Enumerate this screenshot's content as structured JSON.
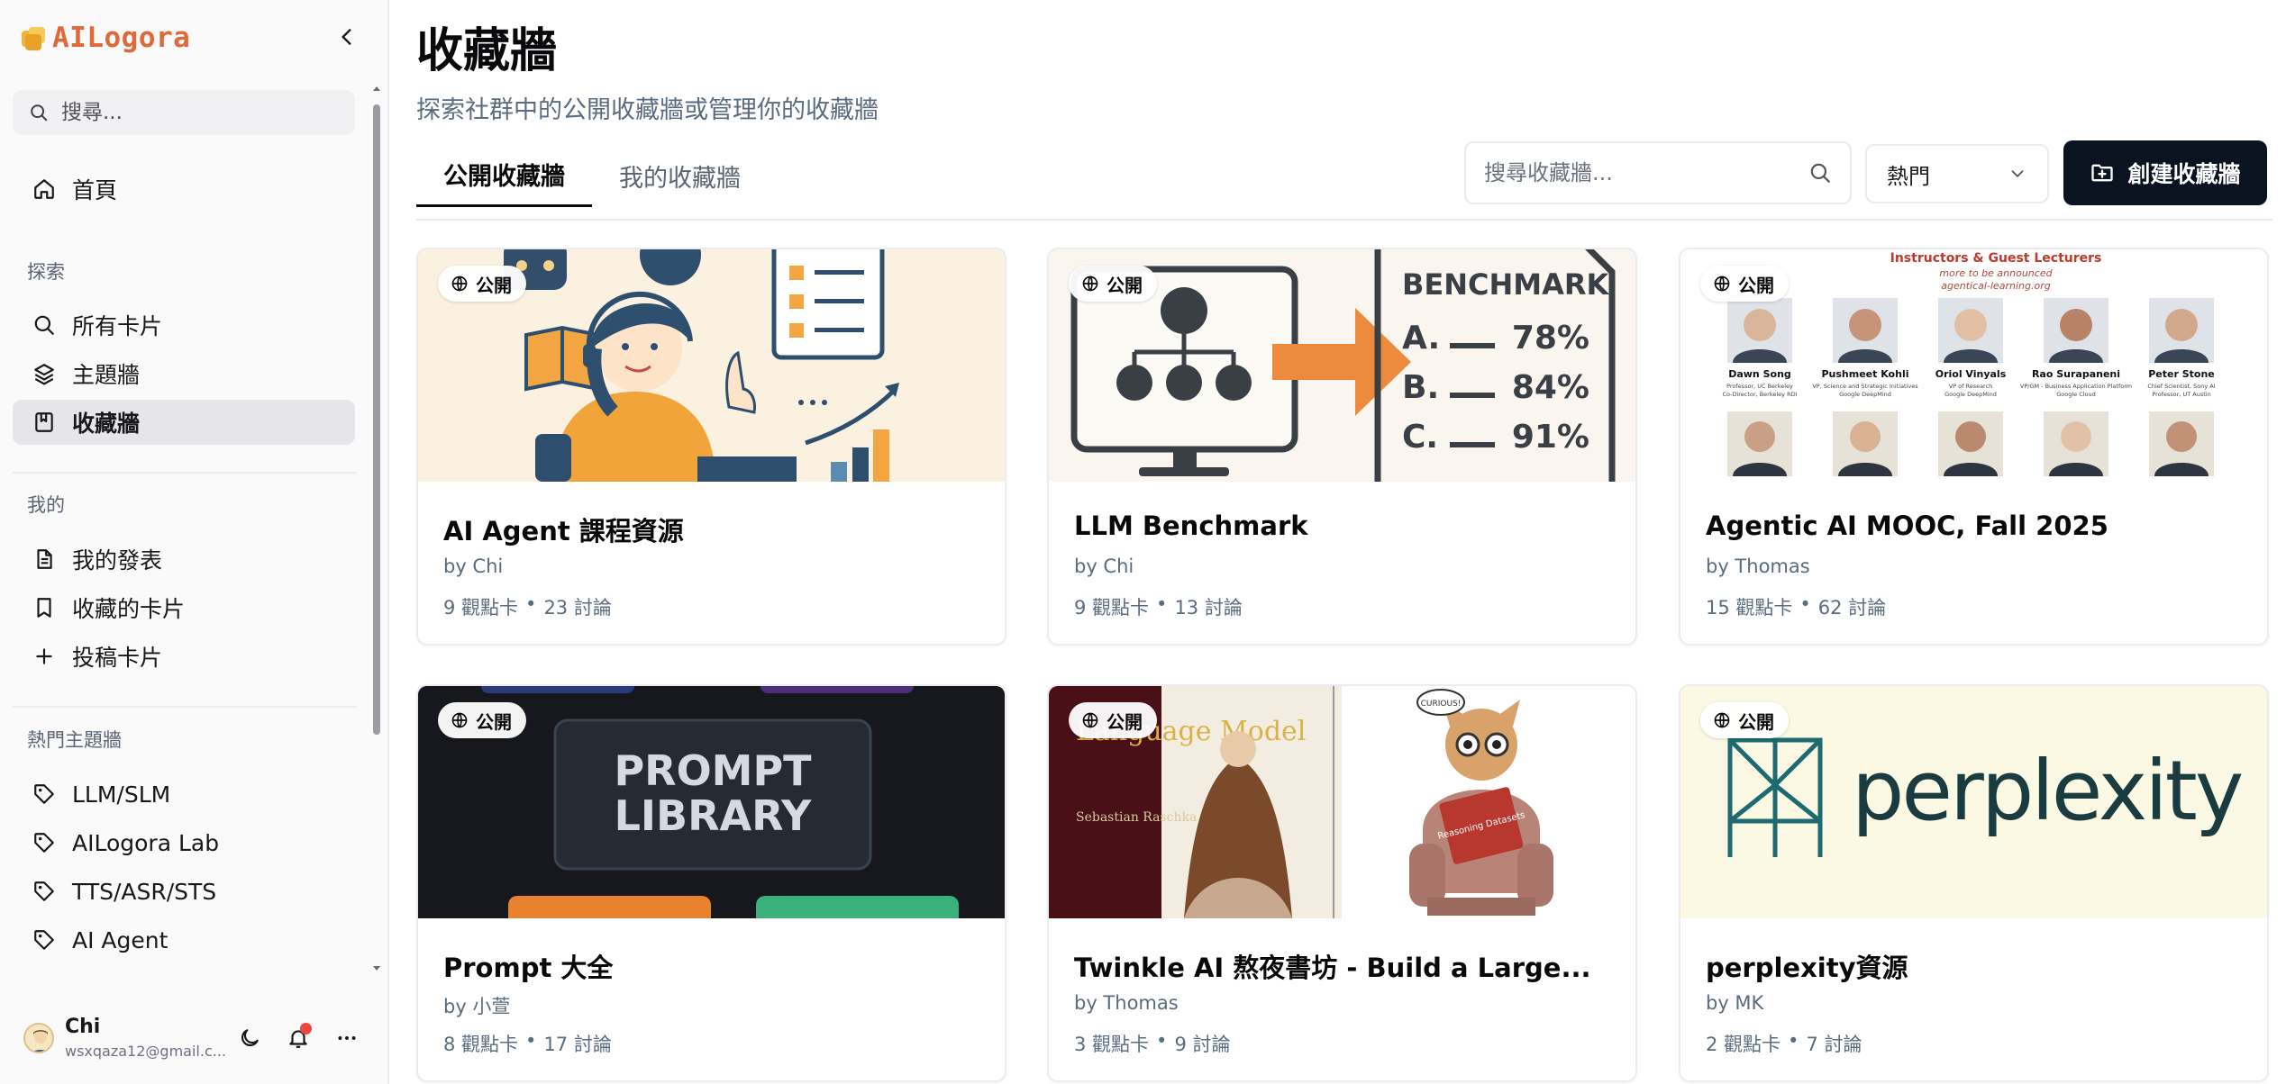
{
  "app": {
    "logo_text": "AILogora"
  },
  "sidebar": {
    "search_placeholder": "搜尋...",
    "home": "首頁",
    "explore_label": "探索",
    "explore_items": [
      "所有卡片",
      "主題牆",
      "收藏牆"
    ],
    "mine_label": "我的",
    "mine_items": [
      "我的發表",
      "收藏的卡片",
      "投稿卡片"
    ],
    "hot_label": "熱門主題牆",
    "hot_items": [
      "LLM/SLM",
      "AILogora Lab",
      "TTS/ASR/STS",
      "AI Agent"
    ],
    "user": {
      "name": "Chi",
      "email": "wsxqaza12@gmail.c..."
    }
  },
  "main": {
    "title": "收藏牆",
    "subtitle": "探索社群中的公開收藏牆或管理你的收藏牆",
    "tabs": [
      "公開收藏牆",
      "我的收藏牆"
    ],
    "search_placeholder": "搜尋收藏牆...",
    "sort_value": "熱門",
    "create_label": "創建收藏牆"
  },
  "cards": [
    {
      "badge": "公開",
      "title": "AI Agent 課程資源",
      "author": "by Chi",
      "cards": "9 觀點卡",
      "discussions": "23 討論"
    },
    {
      "badge": "公開",
      "title": "LLM Benchmark",
      "author": "by Chi",
      "cards": "9 觀點卡",
      "discussions": "13 討論"
    },
    {
      "badge": "公開",
      "title": "Agentic AI MOOC, Fall 2025",
      "author": "by Thomas",
      "cards": "15 觀點卡",
      "discussions": "62 討論"
    },
    {
      "badge": "公開",
      "title": "Prompt 大全",
      "author": "by 小萱",
      "cards": "8 觀點卡",
      "discussions": "17 討論"
    },
    {
      "badge": "公開",
      "title": "Twinkle AI 熬夜書坊 - Build a Large...",
      "author": "by Thomas",
      "cards": "3 觀點卡",
      "discussions": "9 討論"
    },
    {
      "badge": "公開",
      "title": "perplexity資源",
      "author": "by MK",
      "cards": "2 觀點卡",
      "discussions": "7 討論"
    }
  ],
  "thumbs": {
    "benchmark": {
      "heading": "BENCHMARK",
      "rows": [
        {
          "letter": "A.",
          "value": "78%"
        },
        {
          "letter": "B.",
          "value": "84%"
        },
        {
          "letter": "C.",
          "value": "91%"
        }
      ]
    },
    "mooc": {
      "heading": "Instructors & Guest Lecturers",
      "subheading": "more to be announced",
      "site": "agentical-learning.org",
      "people": [
        {
          "name": "Dawn Song",
          "role": "Professor, UC Berkeley / Co-Director, Berkeley RDI"
        },
        {
          "name": "Pushmeet Kohli",
          "role": "VP, Science and Strategic Initiatives / Google DeepMind"
        },
        {
          "name": "Oriol Vinyals",
          "role": "VP of Research / Google DeepMind"
        },
        {
          "name": "Rao Surapaneni",
          "role": "VP/GM - Business Application Platform / Google Cloud"
        },
        {
          "name": "Peter Stone",
          "role": "Chief Scientist, Sony AI / Professor, UT Austin"
        }
      ]
    },
    "prompt": {
      "line1": "PROMPT",
      "line2": "LIBRARY"
    },
    "book": {
      "title": "Language Model",
      "author": "Sebastian Raschka",
      "bubble": "CURIOUS!",
      "book_cover": "Reasoning Datasets"
    },
    "perplexity": {
      "wordmark": "perplexity"
    }
  },
  "separator": "•"
}
